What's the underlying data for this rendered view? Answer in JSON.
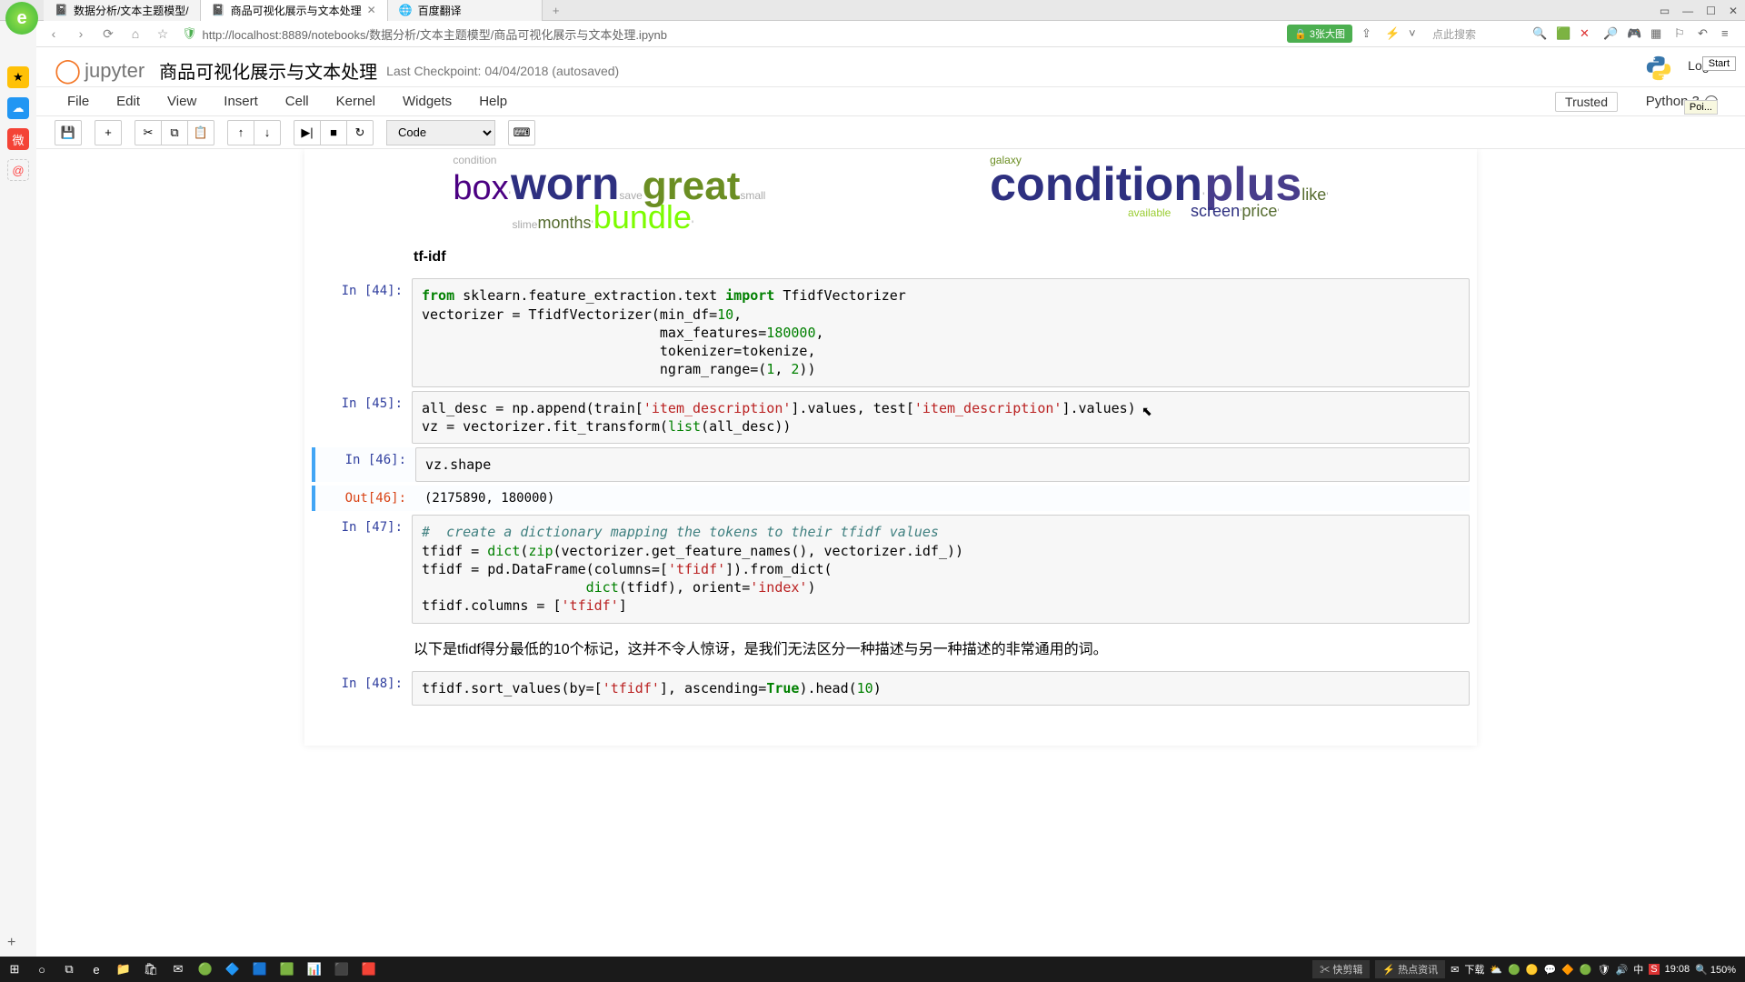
{
  "browser": {
    "tabs": [
      {
        "title": "数据分析/文本主题模型/",
        "icon": "🟠"
      },
      {
        "title": "商品可视化展示与文本处理",
        "icon": "🟠",
        "active": true
      },
      {
        "title": "百度翻译",
        "icon": "🔵"
      }
    ],
    "url": "http://localhost:8889/notebooks/数据分析/文本主题模型/商品可视化展示与文本处理.ipynb",
    "search_placeholder": "点此搜索",
    "green_pill": "🔒 3张大图"
  },
  "jupyter": {
    "logo_text": "jupyter",
    "notebook_name": "商品可视化展示与文本处理",
    "checkpoint": "Last Checkpoint: 04/04/2018 (autosaved)",
    "logout": "Logout",
    "start_badge": "Start",
    "tooltip": "Poi...",
    "menu": [
      "File",
      "Edit",
      "View",
      "Insert",
      "Cell",
      "Kernel",
      "Widgets",
      "Help"
    ],
    "trusted": "Trusted",
    "kernel": "Python 3",
    "cell_type_select": "Code"
  },
  "cells": {
    "tfidf_heading": "tf-idf",
    "c44": {
      "prompt": "In [44]:",
      "l1a": "from",
      "l1b": " sklearn.feature_extraction.text ",
      "l1c": "import",
      "l1d": " TfidfVectorizer",
      "l2a": "vectorizer = TfidfVectorizer(min_df=",
      "l2b": "10",
      "l2c": ",",
      "l3a": "                             max_features=",
      "l3b": "180000",
      "l3c": ",",
      "l4": "                             tokenizer=tokenize,",
      "l5a": "                             ngram_range=(",
      "l5b": "1",
      "l5c": ", ",
      "l5d": "2",
      "l5e": "))"
    },
    "c45": {
      "prompt": "In [45]:",
      "l1a": "all_desc = np.append(train[",
      "l1b": "'item_description'",
      "l1c": "].values, test[",
      "l1d": "'item_description'",
      "l1e": "].values)",
      "l2a": "vz = vectorizer.fit_transform(",
      "l2b": "list",
      "l2c": "(all_desc))"
    },
    "c46": {
      "prompt": "In [46]:",
      "code": "vz.shape",
      "out_prompt": "Out[46]:",
      "out": "(2175890, 180000)"
    },
    "c47": {
      "prompt": "In [47]:",
      "l1": "#  create a dictionary mapping the tokens to their tfidf values",
      "l2a": "tfidf = ",
      "l2b": "dict",
      "l2c": "(",
      "l2d": "zip",
      "l2e": "(vectorizer.get_feature_names(), vectorizer.idf_))",
      "l3a": "tfidf = pd.DataFrame(columns=[",
      "l3b": "'tfidf'",
      "l3c": "]).from_dict(",
      "l4a": "                    ",
      "l4b": "dict",
      "l4c": "(tfidf), orient=",
      "l4d": "'index'",
      "l4e": ")",
      "l5a": "tfidf.columns = [",
      "l5b": "'tfidf'",
      "l5c": "]"
    },
    "text_para": "以下是tfidf得分最低的10个标记，这并不令人惊讶，是我们无法区分一种描述与另一种描述的非常通用的词。",
    "c48": {
      "prompt": "In [48]:",
      "l1a": "tfidf.sort_values(by=[",
      "l1b": "'tfidf'",
      "l1c": "], ascending=",
      "l1d": "True",
      "l1e": ").head(",
      "l1f": "10",
      "l1g": ")"
    }
  },
  "wordcloud": {
    "left": [
      "condition",
      "box",
      "worn",
      "months",
      "bundle",
      "great",
      "save",
      "slime",
      "small"
    ],
    "right": [
      "condition",
      "plus",
      "like",
      "screen",
      "price",
      "galaxy",
      "available"
    ]
  },
  "taskbar": {
    "news": [
      "快剪辑",
      "热点资讯",
      "✉",
      "下载",
      "⛅"
    ],
    "time": "19:08",
    "zoom": "🔍 150%"
  }
}
